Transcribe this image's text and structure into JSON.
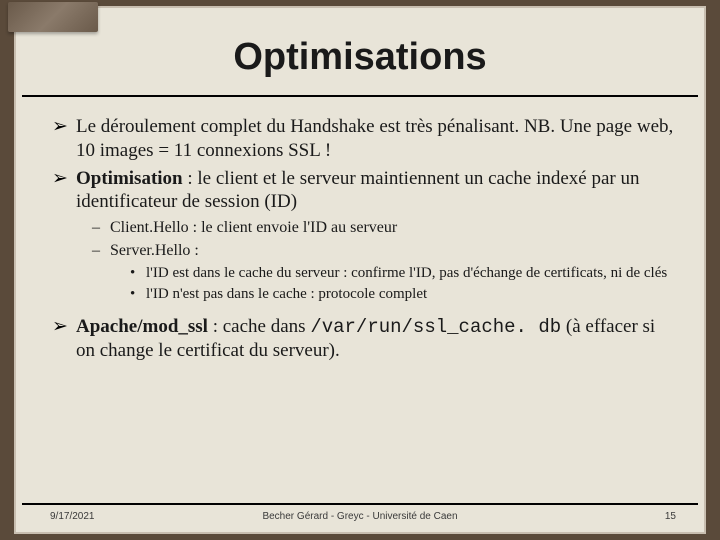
{
  "title": "Optimisations",
  "bullets": [
    {
      "level": 1,
      "runs": [
        {
          "text": "Le déroulement complet du Handshake est très pénalisant. NB. Une page web, 10 images = 11 connexions SSL !"
        }
      ]
    },
    {
      "level": 1,
      "runs": [
        {
          "text": "Optimisation",
          "bold": true
        },
        {
          "text": " : le client et le serveur maintiennent un cache indexé par un identificateur de session (ID)"
        }
      ]
    },
    {
      "level": 2,
      "runs": [
        {
          "text": "Client.Hello : le client envoie l'ID au serveur"
        }
      ]
    },
    {
      "level": 2,
      "runs": [
        {
          "text": "Server.Hello :"
        }
      ]
    },
    {
      "level": 3,
      "runs": [
        {
          "text": "l'ID est dans le cache du serveur : confirme l'ID, pas d'échange de certificats, ni de clés"
        }
      ]
    },
    {
      "level": 3,
      "runs": [
        {
          "text": "l'ID n'est pas dans le cache : protocole complet"
        }
      ]
    },
    {
      "level": 1,
      "spaced": true,
      "runs": [
        {
          "text": "Apache/mod_ssl",
          "bold": true
        },
        {
          "text": " : cache dans "
        },
        {
          "text": "/var/run/ssl_cache. db",
          "mono": true
        },
        {
          "text": " (à effacer si on change le certificat du serveur)."
        }
      ]
    }
  ],
  "footer": {
    "date": "9/17/2021",
    "center": "Becher Gérard - Greyc - Université de Caen",
    "page": "15"
  }
}
